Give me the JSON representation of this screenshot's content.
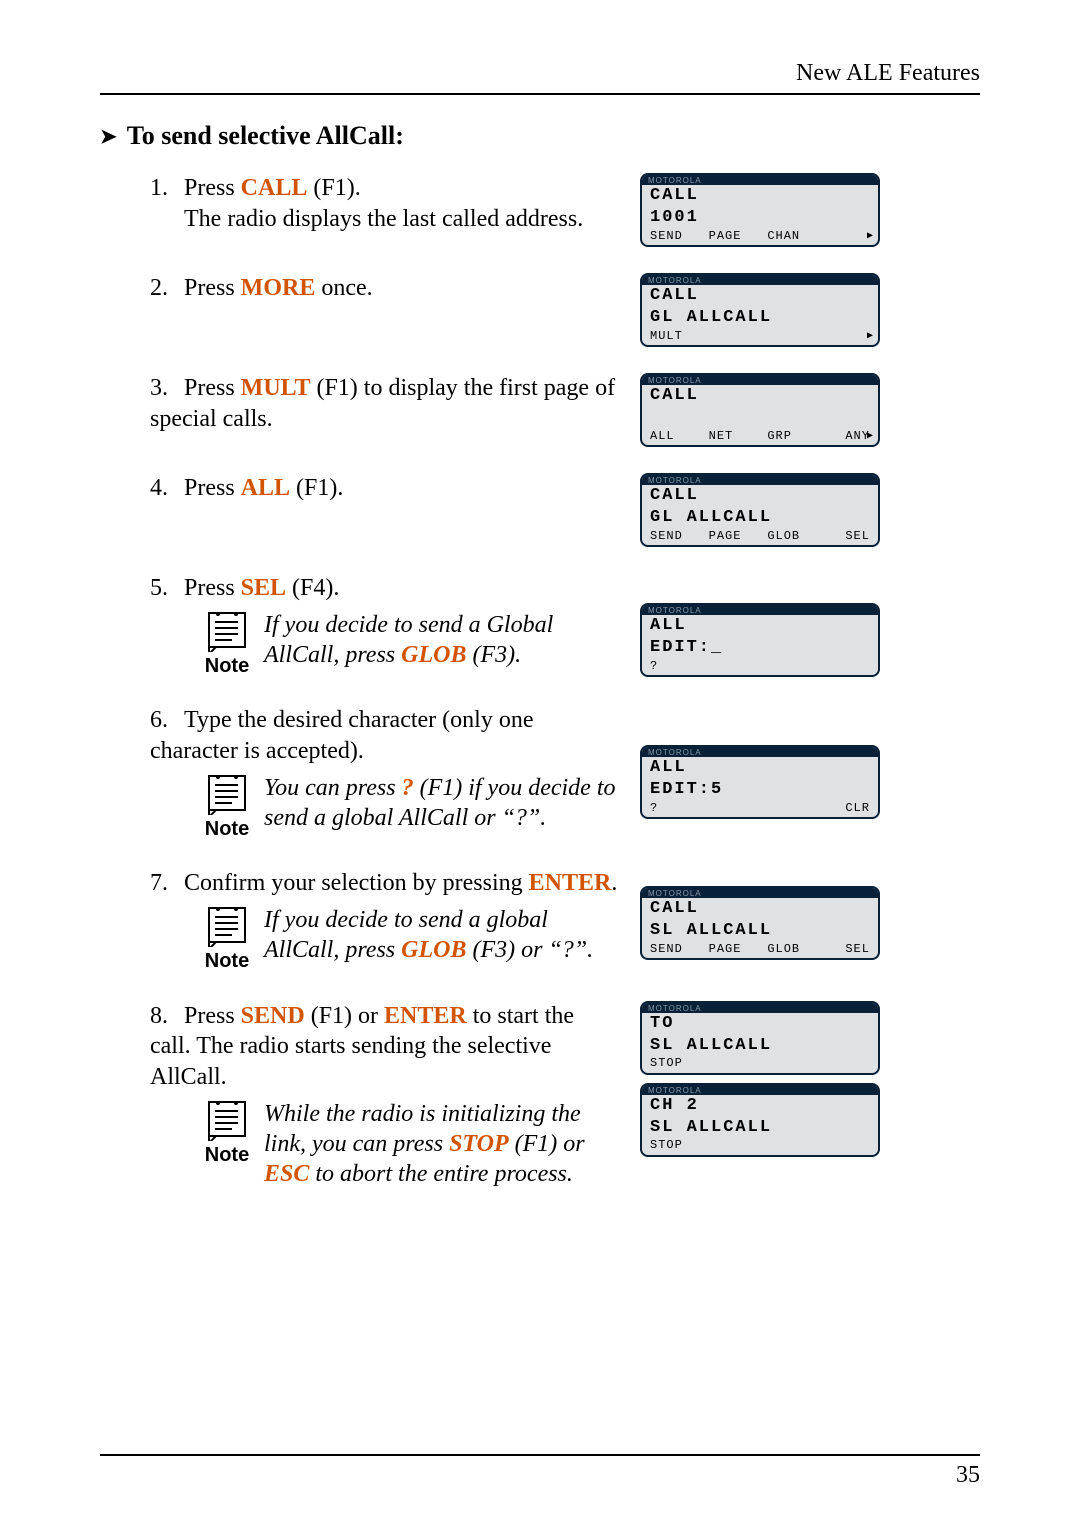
{
  "header": {
    "running_head": "New ALE Features"
  },
  "section": {
    "title": "To send selective AllCall:"
  },
  "page_number": "35",
  "keys": {
    "CALL": "CALL",
    "MORE": "MORE",
    "MULT": "MULT",
    "ALL": "ALL",
    "SEL": "SEL",
    "GLOB": "GLOB",
    "Q": "?",
    "ENTER": "ENTER",
    "SEND": "SEND",
    "STOP": "STOP",
    "ESC": "ESC"
  },
  "note_label": "Note",
  "lcd_brand": "MOTOROLA",
  "steps": {
    "s1": {
      "num": "1.",
      "pre": "Press ",
      "post": " (F1).",
      "follow": "The radio displays the last called address."
    },
    "s2": {
      "num": "2.",
      "pre": "Press ",
      "post": " once."
    },
    "s3": {
      "num": "3.",
      "pre": "Press ",
      "post": " (F1) to display the first page of special calls."
    },
    "s4": {
      "num": "4.",
      "pre": "Press ",
      "post": " (F1)."
    },
    "s5": {
      "num": "5.",
      "pre": "Press ",
      "post": " (F4).",
      "note_a": "If you decide to send a Global AllCall, press ",
      "note_b": " (F3)."
    },
    "s6": {
      "num": "6.",
      "text": "Type the desired character (only one character is accepted).",
      "note_a": "You can press ",
      "note_b": " (F1) if you decide to send a global AllCall or “?”."
    },
    "s7": {
      "num": "7.",
      "pre": "Confirm your selection by pressing ",
      "post": ".",
      "note_a": "If you decide to send a global AllCall, press ",
      "note_b": " (F3) or “?”."
    },
    "s8": {
      "num": "8.",
      "a": "Press ",
      "b": " (F1) or ",
      "c": " to start the call. The radio starts sending the selective AllCall.",
      "note_a": "While the radio is initializing the link, you can press ",
      "note_b": " (F1) or ",
      "note_c": " to abort the entire process."
    }
  },
  "lcd": {
    "d1": {
      "l1": "CALL",
      "l2": "1001",
      "sk": [
        "SEND",
        "PAGE",
        "CHAN",
        ""
      ],
      "arrow": true
    },
    "d2": {
      "l1": "CALL",
      "l2": "GL ALLCALL",
      "sk_single": "MULT",
      "arrow": true
    },
    "d3": {
      "l1": "CALL",
      "l2": " ",
      "sk": [
        "ALL",
        "NET",
        "GRP",
        "ANY"
      ],
      "arrow": true
    },
    "d4": {
      "l1": "CALL",
      "l2": "GL ALLCALL",
      "sk": [
        "SEND",
        "PAGE",
        "GLOB",
        "SEL"
      ]
    },
    "d5": {
      "l1": "ALL",
      "l2": "EDIT:_",
      "sk_single": " ?"
    },
    "d6": {
      "l1": "ALL",
      "l2": "EDIT:5",
      "sk": [
        " ?",
        "",
        "",
        "CLR"
      ]
    },
    "d7": {
      "l1": "CALL",
      "l2": "SL ALLCALL",
      "sk": [
        "SEND",
        "PAGE",
        "GLOB",
        "SEL"
      ]
    },
    "d8a": {
      "l1": "TO",
      "l2": "SL ALLCALL",
      "sk_single": "STOP"
    },
    "d8b": {
      "l1": "CH 2",
      "l2": "SL ALLCALL",
      "sk_single": "STOP"
    }
  }
}
